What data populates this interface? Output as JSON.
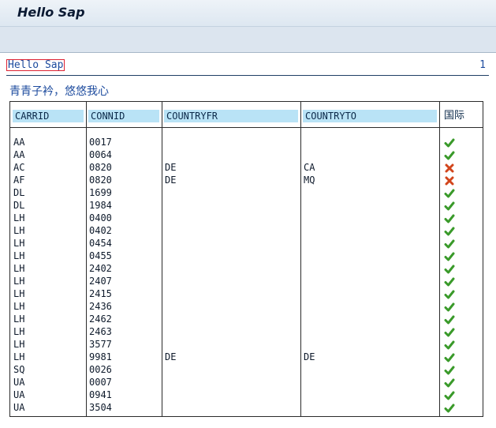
{
  "window": {
    "title": "Hello Sap"
  },
  "report": {
    "header": "Hello Sap",
    "page": "1",
    "subtitle": "青青子衿，悠悠我心"
  },
  "table": {
    "columns": [
      "CARRID",
      "CONNID",
      "COUNTRYFR",
      "COUNTRYTO",
      "国际"
    ],
    "rows": [
      {
        "carrid": "AA",
        "connid": "0017",
        "countryfr": "",
        "countryto": "",
        "status": "check-icon"
      },
      {
        "carrid": "AA",
        "connid": "0064",
        "countryfr": "",
        "countryto": "",
        "status": "check-icon"
      },
      {
        "carrid": "AC",
        "connid": "0820",
        "countryfr": "DE",
        "countryto": "CA",
        "status": "cross-icon"
      },
      {
        "carrid": "AF",
        "connid": "0820",
        "countryfr": "DE",
        "countryto": "MQ",
        "status": "cross-icon"
      },
      {
        "carrid": "DL",
        "connid": "1699",
        "countryfr": "",
        "countryto": "",
        "status": "check-icon"
      },
      {
        "carrid": "DL",
        "connid": "1984",
        "countryfr": "",
        "countryto": "",
        "status": "check-icon"
      },
      {
        "carrid": "LH",
        "connid": "0400",
        "countryfr": "",
        "countryto": "",
        "status": "check-icon"
      },
      {
        "carrid": "LH",
        "connid": "0402",
        "countryfr": "",
        "countryto": "",
        "status": "check-icon"
      },
      {
        "carrid": "LH",
        "connid": "0454",
        "countryfr": "",
        "countryto": "",
        "status": "check-icon"
      },
      {
        "carrid": "LH",
        "connid": "0455",
        "countryfr": "",
        "countryto": "",
        "status": "check-icon"
      },
      {
        "carrid": "LH",
        "connid": "2402",
        "countryfr": "",
        "countryto": "",
        "status": "check-icon"
      },
      {
        "carrid": "LH",
        "connid": "2407",
        "countryfr": "",
        "countryto": "",
        "status": "check-icon"
      },
      {
        "carrid": "LH",
        "connid": "2415",
        "countryfr": "",
        "countryto": "",
        "status": "check-icon"
      },
      {
        "carrid": "LH",
        "connid": "2436",
        "countryfr": "",
        "countryto": "",
        "status": "check-icon"
      },
      {
        "carrid": "LH",
        "connid": "2462",
        "countryfr": "",
        "countryto": "",
        "status": "check-icon"
      },
      {
        "carrid": "LH",
        "connid": "2463",
        "countryfr": "",
        "countryto": "",
        "status": "check-icon"
      },
      {
        "carrid": "LH",
        "connid": "3577",
        "countryfr": "",
        "countryto": "",
        "status": "check-icon"
      },
      {
        "carrid": "LH",
        "connid": "9981",
        "countryfr": "DE",
        "countryto": "DE",
        "status": "check-icon"
      },
      {
        "carrid": "SQ",
        "connid": "0026",
        "countryfr": "",
        "countryto": "",
        "status": "check-icon"
      },
      {
        "carrid": "UA",
        "connid": "0007",
        "countryfr": "",
        "countryto": "",
        "status": "check-icon"
      },
      {
        "carrid": "UA",
        "connid": "0941",
        "countryfr": "",
        "countryto": "",
        "status": "check-icon"
      },
      {
        "carrid": "UA",
        "connid": "3504",
        "countryfr": "",
        "countryto": "",
        "status": "check-icon"
      }
    ]
  },
  "colors": {
    "check": "#3a9a2a",
    "cross": "#d2451c",
    "header_bg": "#b9e3f6",
    "text_blue": "#1d4b9e"
  }
}
